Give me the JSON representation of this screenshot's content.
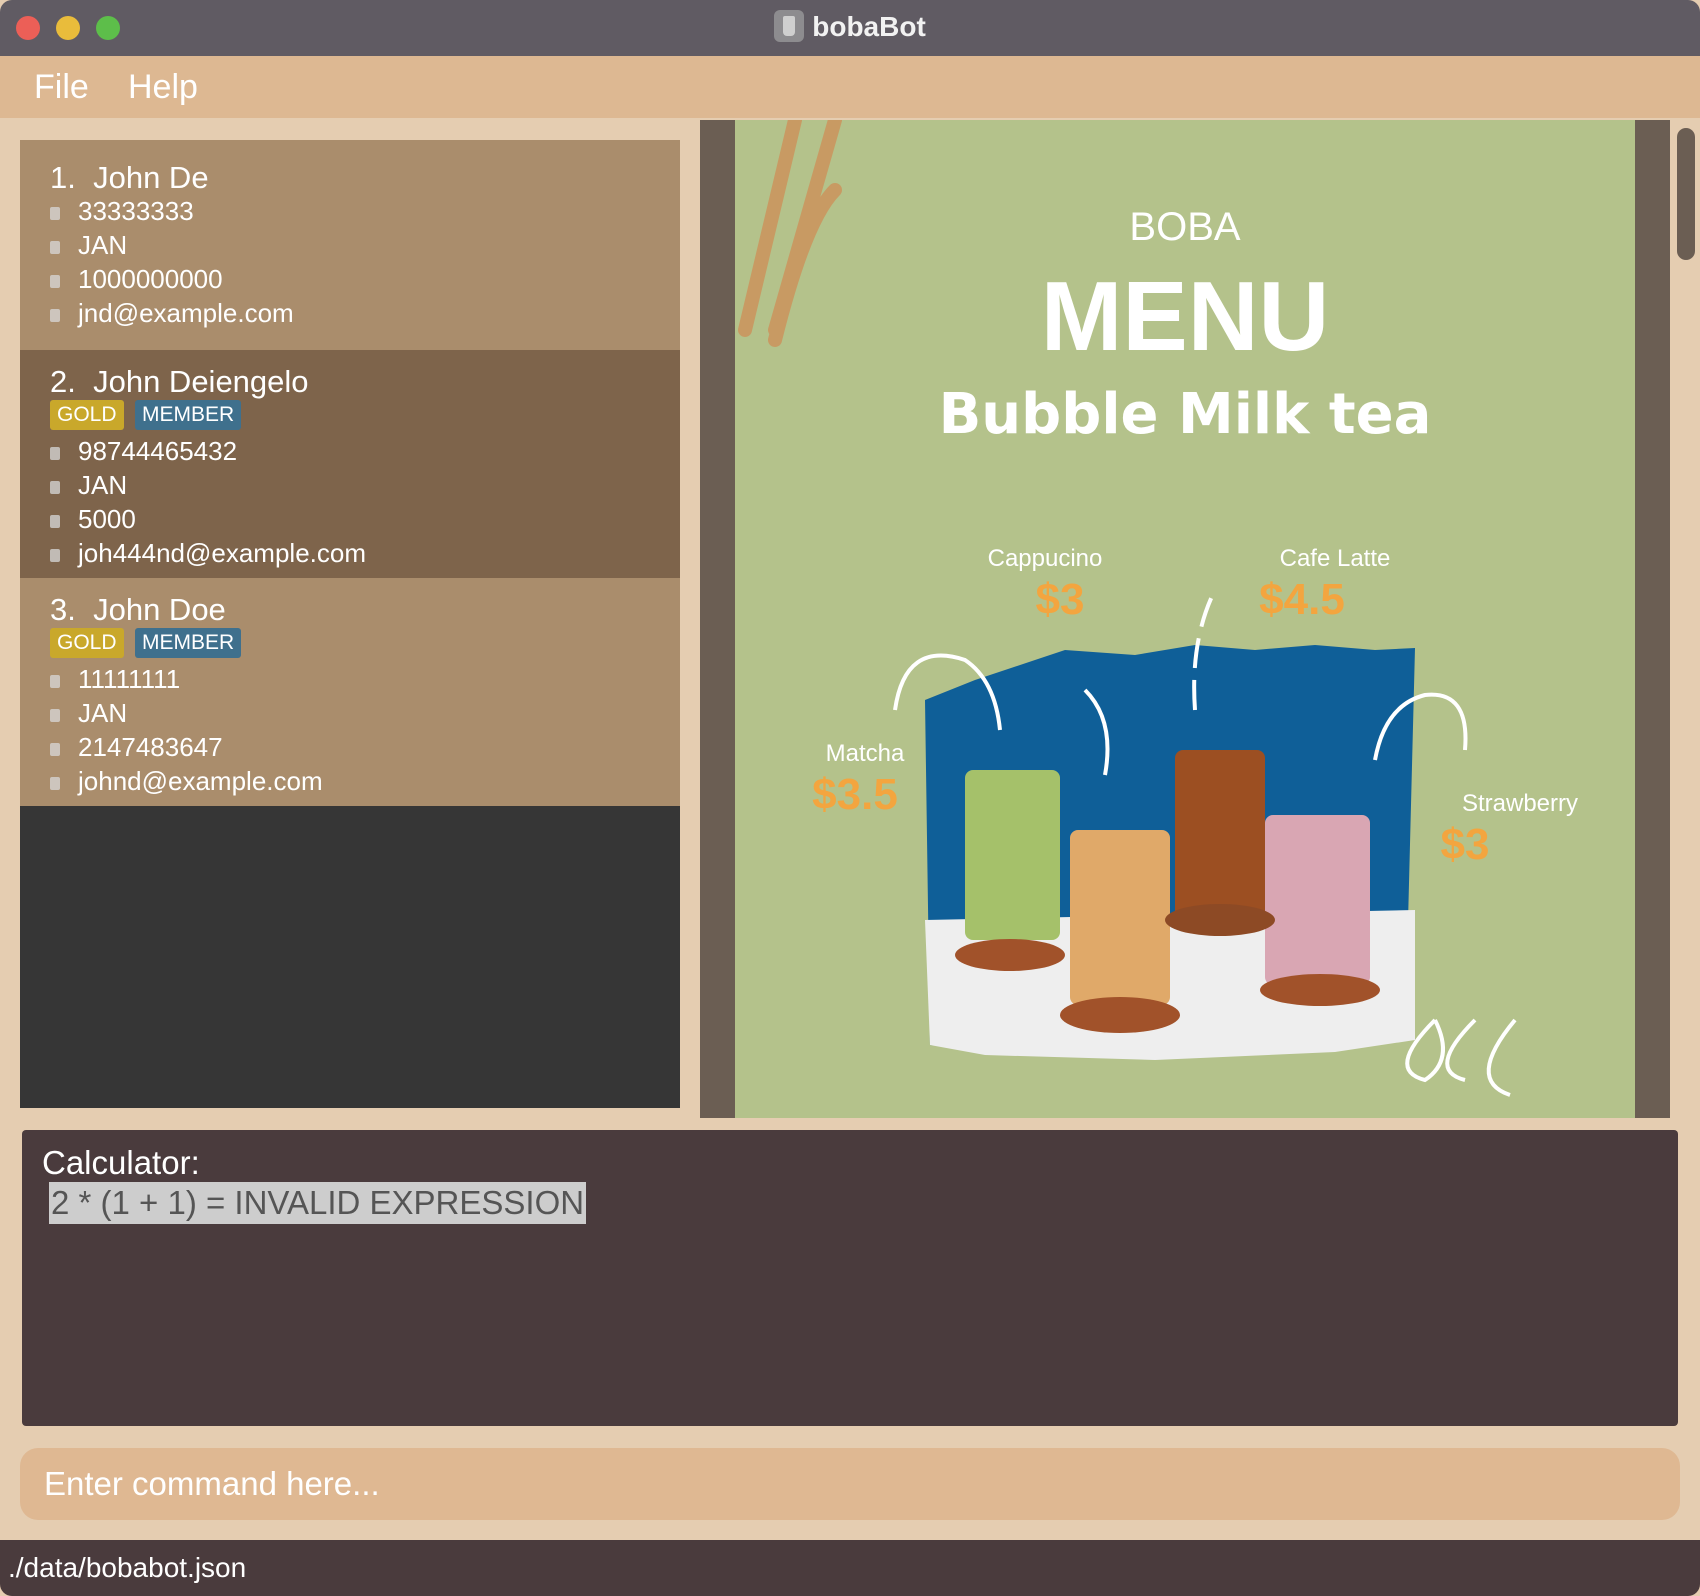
{
  "window": {
    "title": "bobaBot",
    "colors": {
      "close": "#ec5f57",
      "minimize": "#e9bc3b",
      "maximize": "#5dbe4a"
    }
  },
  "menu": {
    "file": "File",
    "help": "Help"
  },
  "persons": [
    {
      "index": "1.",
      "name": "John De",
      "tags": [],
      "phone": "33333333",
      "birthday": "JAN",
      "points": "1000000000",
      "email": "jnd@example.com"
    },
    {
      "index": "2.",
      "name": "John Deiengelo",
      "tags": [
        "GOLD",
        "MEMBER"
      ],
      "phone": "98744465432",
      "birthday": "JAN",
      "points": "5000",
      "email": "joh444nd@example.com"
    },
    {
      "index": "3.",
      "name": "John Doe",
      "tags": [
        "GOLD",
        "MEMBER"
      ],
      "phone": "11111111",
      "birthday": "JAN",
      "points": "2147483647",
      "email": "johnd@example.com"
    }
  ],
  "menu_image": {
    "brand": "BOBA",
    "title": "MENU",
    "subtitle": "Bubble Milk tea",
    "items": [
      {
        "name": "Cappucino",
        "price": "$3"
      },
      {
        "name": "Cafe Latte",
        "price": "$4.5"
      },
      {
        "name": "Matcha",
        "price": "$3.5"
      },
      {
        "name": "Strawberry",
        "price": "$3"
      }
    ]
  },
  "result": {
    "label": "Calculator:",
    "text": "2 * (1 + 1) = INVALID EXPRESSION"
  },
  "command": {
    "placeholder": "Enter command here..."
  },
  "status": {
    "path": "./data/bobabot.json"
  }
}
